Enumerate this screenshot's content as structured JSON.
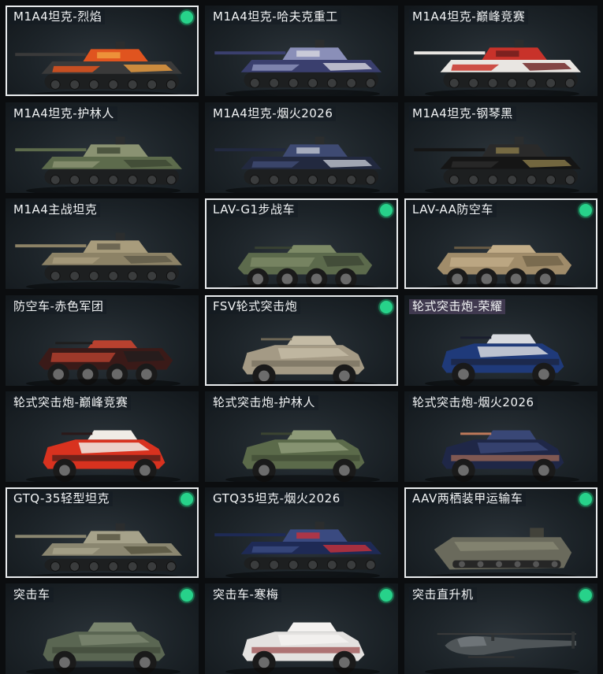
{
  "items": [
    {
      "name": "M1A4坦克-烈焰",
      "kind": "tank",
      "c1": "#3a3a3a",
      "c2": "#e0541f",
      "c3": "#f0a040",
      "selected": true,
      "badge": true,
      "hl": false
    },
    {
      "name": "M1A4坦克-哈夫克重工",
      "kind": "tank",
      "c1": "#3a3f6e",
      "c2": "#8a8fb8",
      "c3": "#d8d8e0",
      "selected": false,
      "badge": false,
      "hl": false
    },
    {
      "name": "M1A4坦克-巅峰竞赛",
      "kind": "tank",
      "c1": "#e9e6e2",
      "c2": "#c8322a",
      "c3": "#6a1d1d",
      "selected": false,
      "badge": false,
      "hl": false
    },
    {
      "name": "M1A4坦克-护林人",
      "kind": "tank",
      "c1": "#5d6b4c",
      "c2": "#8a9272",
      "c3": "#3d4733",
      "selected": false,
      "badge": false,
      "hl": false
    },
    {
      "name": "M1A4坦克-烟火2026",
      "kind": "tank",
      "c1": "#22293f",
      "c2": "#3e4a72",
      "c3": "#c0c4d0",
      "selected": false,
      "badge": false,
      "hl": false
    },
    {
      "name": "M1A4坦克-钢琴黑",
      "kind": "tank",
      "c1": "#151515",
      "c2": "#2a2a2a",
      "c3": "#8a7a4a",
      "selected": false,
      "badge": false,
      "hl": false
    },
    {
      "name": "M1A4主战坦克",
      "kind": "tank",
      "c1": "#8c8266",
      "c2": "#a89c7c",
      "c3": "#5f5a48",
      "selected": false,
      "badge": false,
      "hl": false
    },
    {
      "name": "LAV-G1步战车",
      "kind": "ifv",
      "c1": "#5c6a4c",
      "c2": "#7d8a66",
      "c3": "#394232",
      "selected": true,
      "badge": true,
      "hl": false
    },
    {
      "name": "LAV-AA防空车",
      "kind": "ifv",
      "c1": "#a08c6a",
      "c2": "#c2ad88",
      "c3": "#6a5c45",
      "selected": true,
      "badge": true,
      "hl": false
    },
    {
      "name": "防空车-赤色军团",
      "kind": "ifv",
      "c1": "#3a1a18",
      "c2": "#b8412f",
      "c3": "#1e1e1e",
      "selected": false,
      "badge": false,
      "hl": false
    },
    {
      "name": "FSV轮式突击炮",
      "kind": "armored",
      "c1": "#a49a85",
      "c2": "#c4bba5",
      "c3": "#6e6756",
      "selected": true,
      "badge": true,
      "hl": false
    },
    {
      "name": "轮式突击炮-荣耀",
      "kind": "armored",
      "c1": "#1f3a7a",
      "c2": "#d8dadf",
      "c3": "#1a1e2e",
      "selected": false,
      "badge": false,
      "hl": true
    },
    {
      "name": "轮式突击炮-巅峰竞赛",
      "kind": "armored",
      "c1": "#d8321f",
      "c2": "#f0ece6",
      "c3": "#2a1818",
      "selected": false,
      "badge": false,
      "hl": false
    },
    {
      "name": "轮式突击炮-护林人",
      "kind": "armored",
      "c1": "#5b6a4a",
      "c2": "#8e9a78",
      "c3": "#3b4431",
      "selected": false,
      "badge": false,
      "hl": false
    },
    {
      "name": "轮式突击炮-烟火2026",
      "kind": "armored",
      "c1": "#1f2747",
      "c2": "#394776",
      "c3": "#c07a5a",
      "selected": false,
      "badge": false,
      "hl": false
    },
    {
      "name": "GTQ-35轻型坦克",
      "kind": "light",
      "c1": "#8a8670",
      "c2": "#a6a28a",
      "c3": "#55523f",
      "selected": true,
      "badge": true,
      "hl": false
    },
    {
      "name": "GTQ35坦克-烟火2026",
      "kind": "light",
      "c1": "#1e2a55",
      "c2": "#3a4a80",
      "c3": "#c8313a",
      "selected": false,
      "badge": false,
      "hl": false
    },
    {
      "name": "AAV两栖装甲运输车",
      "kind": "aav",
      "c1": "#6a6a5c",
      "c2": "#888874",
      "c3": "#42423a",
      "selected": true,
      "badge": true,
      "hl": false
    },
    {
      "name": "突击车",
      "kind": "truck",
      "c1": "#5a6652",
      "c2": "#7a856e",
      "c3": "#3a4236",
      "selected": false,
      "badge": true,
      "hl": false
    },
    {
      "name": "突击车-寒梅",
      "kind": "truck",
      "c1": "#e4e2e0",
      "c2": "#f4f2f0",
      "c3": "#8a2a2a",
      "selected": false,
      "badge": true,
      "hl": false
    },
    {
      "name": "突击直升机",
      "kind": "heli",
      "c1": "#4f5558",
      "c2": "#6e7478",
      "c3": "#2e3234",
      "selected": false,
      "badge": true,
      "hl": false
    }
  ]
}
